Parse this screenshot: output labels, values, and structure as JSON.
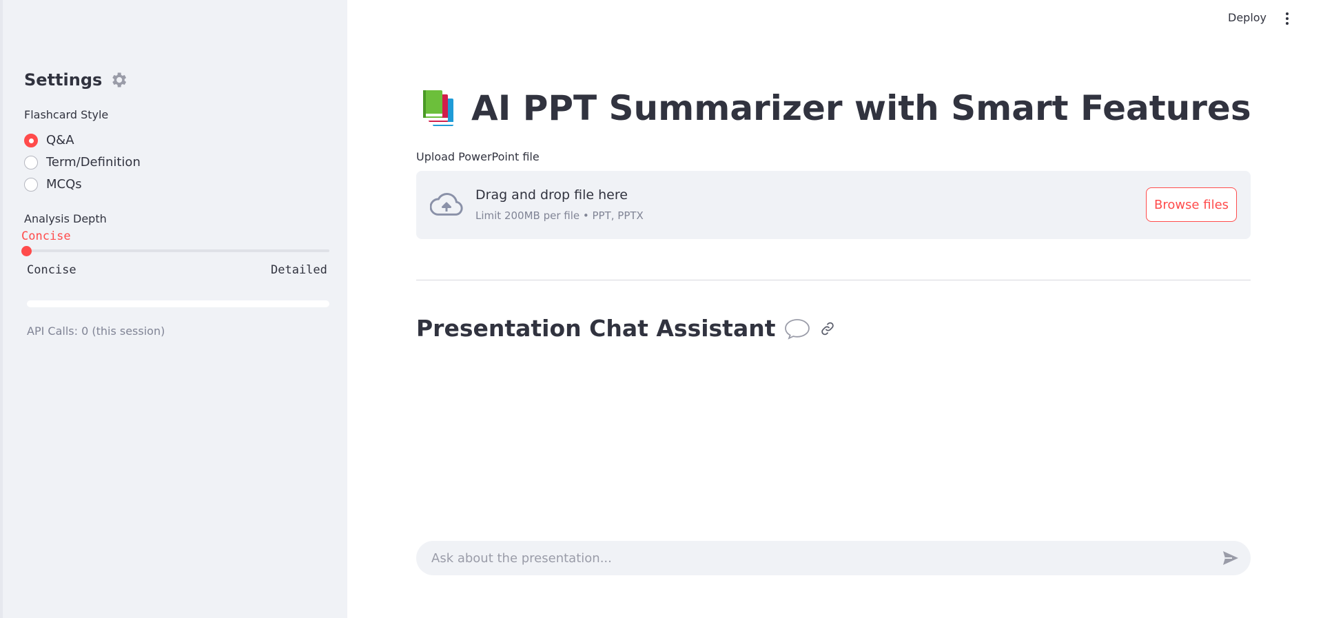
{
  "sidebar": {
    "title": "Settings",
    "flashcard_label": "Flashcard Style",
    "flashcard_options": [
      "Q&A",
      "Term/Definition",
      "MCQs"
    ],
    "flashcard_selected": "Q&A",
    "depth_label": "Analysis Depth",
    "depth_value": "Concise",
    "depth_min": "Concise",
    "depth_max": "Detailed",
    "depth_level": 0,
    "progress_value": 0,
    "api_calls": "API Calls: 0 (this session)"
  },
  "header": {
    "deploy_label": "Deploy"
  },
  "main": {
    "title": "AI PPT Summarizer with Smart Features",
    "upload_label": "Upload PowerPoint file",
    "dropzone_main": "Drag and drop file here",
    "dropzone_sub": "Limit 200MB per file • PPT, PPTX",
    "browse_label": "Browse files",
    "chat_title": "Presentation Chat Assistant",
    "chat_placeholder": "Ask about the presentation..."
  },
  "colors": {
    "accent": "#ff4b4b",
    "sidebar_bg": "#f0f2f6",
    "text": "#31333f",
    "muted": "#808495"
  },
  "icons": {
    "settings": "gear-icon",
    "title": "books-icon",
    "upload": "cloud-upload-icon",
    "chat": "speech-bubble-icon",
    "anchor": "link-icon",
    "send": "send-icon",
    "menu": "kebab-menu-icon"
  }
}
